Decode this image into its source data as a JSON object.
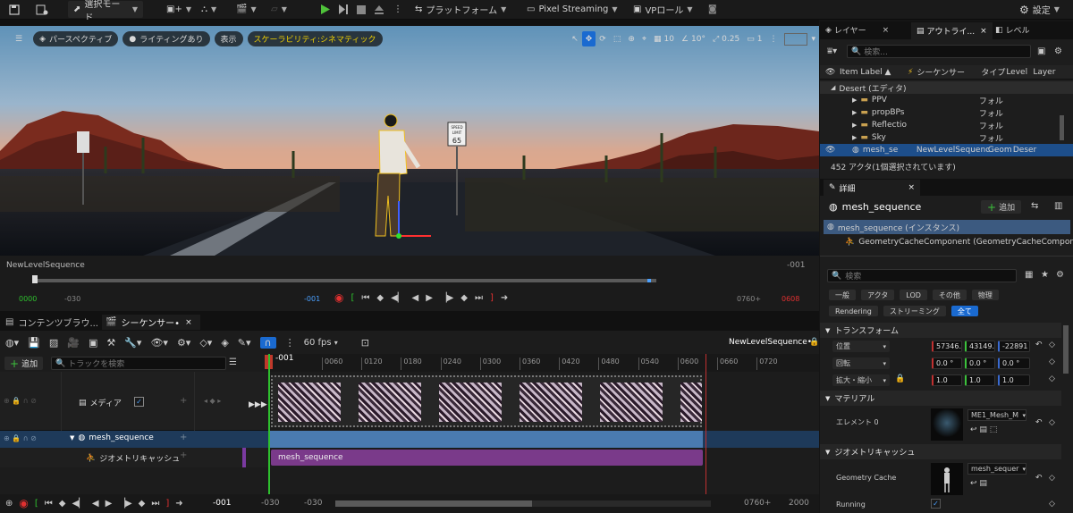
{
  "toolbar": {
    "mode": "選択モード",
    "platform": "プラットフォーム",
    "pixel_streaming": "Pixel Streaming",
    "vp_role": "VPロール",
    "settings": "設定"
  },
  "viewport": {
    "perspective": "パースペクティブ",
    "lighting": "ライティングあり",
    "show": "表示",
    "scalability": "スケーラビリティ:シネマティック",
    "grid": "10",
    "angle": "10°",
    "scale": "0.25",
    "camera": "1",
    "sign": "SPEED\nLIMIT\n65"
  },
  "vp_timeline": {
    "sequence_name": "NewLevelSequence",
    "current": "-001",
    "start_green": "0000",
    "left_offset": "-030",
    "center": "-001",
    "end_offset": "0760+",
    "end_red": "0608"
  },
  "tabs": {
    "content": "コンテンツブラウ...",
    "sequencer": "シーケンサー•"
  },
  "sequencer": {
    "fps": "60 fps",
    "sequence_title": "NewLevelSequence•",
    "add": "追加",
    "search_placeholder": "トラックを検索",
    "playhead": "-001",
    "ruler": [
      "0060",
      "0120",
      "0180",
      "0240",
      "0300",
      "0360",
      "0420",
      "0480",
      "0540",
      "0600",
      "0660",
      "0720"
    ],
    "tracks": {
      "media": "メディア",
      "mesh_sequence": "mesh_sequence",
      "geocache": "ジオメトリキャッシュ"
    },
    "clip_label": "mesh_sequence",
    "bottom": {
      "current": "-001",
      "left1": "-030",
      "left2": "-030",
      "right1": "0760+",
      "right2": "2000"
    }
  },
  "outliner": {
    "tabs": [
      "レイヤー",
      "アウトライ...",
      "レベル"
    ],
    "search_placeholder": "検索...",
    "cols": {
      "label": "Item Label",
      "seq": "シーケンサー",
      "type": "タイプ",
      "level": "Level",
      "layer": "Layer"
    },
    "root": "Desert (エディタ)",
    "items": [
      {
        "name": "PPV",
        "type": "フォル"
      },
      {
        "name": "propBPs",
        "type": "フォル"
      },
      {
        "name": "Reflectio",
        "type": "フォル"
      },
      {
        "name": "Sky",
        "type": "フォル"
      }
    ],
    "selected": {
      "name": "mesh_se",
      "seq": "NewLevelSequenc",
      "type": "Geom",
      "level": "Deser"
    },
    "status": "452 アクタ(1個選択されています)"
  },
  "details": {
    "tab": "詳細",
    "object": "mesh_sequence",
    "add": "追加",
    "instance": "mesh_sequence (インスタンス)",
    "component": "GeometryCacheComponent (GeometryCacheComponen",
    "search_placeholder": "検索",
    "cats1": [
      "一般",
      "アクタ",
      "LOD",
      "その他",
      "物理"
    ],
    "cats2": [
      "Rendering",
      "ストリーミング",
      "全て"
    ],
    "transform": {
      "section": "トランスフォーム",
      "loc_label": "位置",
      "rot_label": "回転",
      "scale_label": "拡大・縮小",
      "loc": [
        "57346.",
        "43149.",
        "-22891"
      ],
      "rot": [
        "0.0 °",
        "0.0 °",
        "0.0 °"
      ],
      "scl": [
        "1.0",
        "1.0",
        "1.0"
      ]
    },
    "material": {
      "section": "マテリアル",
      "element": "エレメント 0",
      "value": "ME1_Mesh_M"
    },
    "geocache": {
      "section": "ジオメトリキャッシュ",
      "label": "Geometry Cache",
      "value": "mesh_sequer"
    },
    "running": "Running"
  }
}
